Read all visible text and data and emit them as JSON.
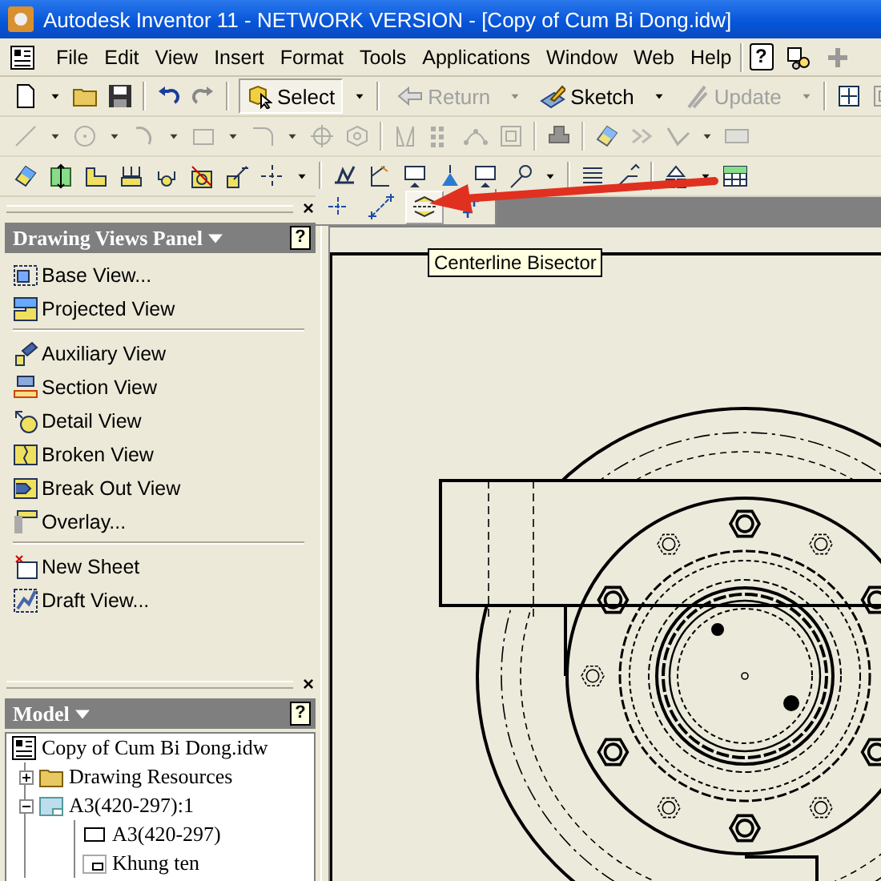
{
  "window": {
    "title": "Autodesk Inventor 11 - NETWORK VERSION - [Copy of Cum Bi Dong.idw]"
  },
  "menu": {
    "items": [
      "File",
      "Edit",
      "View",
      "Insert",
      "Format",
      "Tools",
      "Applications",
      "Window",
      "Web",
      "Help"
    ],
    "help": "?"
  },
  "standard_toolbar": {
    "buttons": [
      {
        "label": "Select",
        "selected": true,
        "disabled": false
      },
      {
        "label": "Return",
        "selected": false,
        "disabled": true
      },
      {
        "label": "Sketch",
        "selected": false,
        "disabled": false
      },
      {
        "label": "Update",
        "selected": false,
        "disabled": true
      }
    ]
  },
  "sketch_toolbar": {
    "disabled": true
  },
  "centerline_flyout": {
    "items": [
      {
        "selected": false
      },
      {
        "selected": false
      },
      {
        "selected": true
      },
      {
        "selected": false
      }
    ]
  },
  "tooltip": "Centerline Bisector",
  "drawing_views_panel": {
    "close": "×",
    "title": "Drawing Views Panel",
    "help": "?",
    "groups": [
      [
        "Base View...",
        "Projected View"
      ],
      [
        "Auxiliary View",
        "Section View",
        "Detail View",
        "Broken View",
        "Break Out View",
        "Overlay..."
      ],
      [
        "New Sheet",
        "Draft View..."
      ]
    ]
  },
  "model_browser": {
    "close": "×",
    "title": "Model",
    "help": "?",
    "tree": [
      {
        "label": "Copy of Cum Bi Dong.idw",
        "children": [
          {
            "label": "Drawing Resources",
            "expanded": false
          },
          {
            "label": "A3(420-297):1",
            "expanded": true,
            "children": [
              {
                "label": "A3(420-297)"
              },
              {
                "label": "Khung ten"
              }
            ]
          }
        ]
      }
    ]
  }
}
